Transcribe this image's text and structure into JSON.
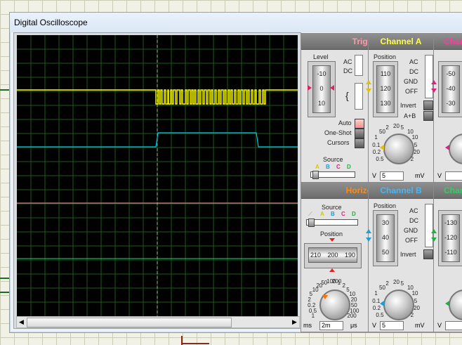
{
  "window": {
    "title": "Digital Oscilloscope"
  },
  "scroll": {
    "left": "◀",
    "right": "▶"
  },
  "colors": {
    "trace_a": "#ffff00",
    "trace_b": "#00c8e8",
    "trace_c": "#ff8fa0",
    "trace_d": "#30d070",
    "cursor": "#b0b0a0",
    "grid": "#1a5a1a"
  },
  "trigger": {
    "title": "Trigger",
    "level_label": "Level",
    "level_ticks": [
      "-10",
      "0",
      "10"
    ],
    "ac": "AC",
    "dc": "DC",
    "auto": "Auto",
    "one_shot": "One-Shot",
    "cursors": "Cursors",
    "source_label": "Source",
    "source_letters": [
      "A",
      "B",
      "C",
      "D"
    ]
  },
  "channel_a": {
    "title": "Channel A",
    "position_label": "Position",
    "position_ticks": [
      "110",
      "120",
      "130"
    ],
    "modes": [
      "AC",
      "DC",
      "GND",
      "OFF"
    ],
    "invert": "Invert",
    "aplusb": "A+B",
    "dial_labels": [
      "0.5",
      "0.2",
      "0.1",
      "1",
      "50",
      "2",
      "20",
      "5",
      "10",
      "10",
      "5",
      "20",
      "2"
    ],
    "value": "5",
    "unit_left": "V",
    "unit_right": "mV"
  },
  "channel_c": {
    "title": "Char",
    "position_ticks": [
      "-50",
      "-40",
      "-30"
    ],
    "unit_left": "V"
  },
  "horizontal": {
    "title": "Horizontal",
    "source_label": "Source",
    "source_letters": [
      "A",
      "B",
      "C",
      "D"
    ],
    "position_label": "Position",
    "position_ticks": [
      "210",
      "200",
      "190"
    ],
    "dial_labels": [
      "1",
      "0.5",
      "0.2",
      "2",
      "5",
      "10",
      "20",
      "50",
      "100",
      "200",
      "1",
      "2",
      "5",
      "10",
      "20",
      "50",
      "100",
      "200"
    ],
    "value": "2m",
    "unit_left": "ms",
    "unit_right": "μs"
  },
  "channel_b": {
    "title": "Channel B",
    "position_label": "Position",
    "position_ticks": [
      "30",
      "40",
      "50"
    ],
    "modes": [
      "AC",
      "DC",
      "GND",
      "OFF"
    ],
    "invert": "Invert",
    "dial_labels": [
      "0.5",
      "0.2",
      "0.1",
      "1",
      "50",
      "2",
      "20",
      "5",
      "10",
      "10",
      "5",
      "20",
      "2"
    ],
    "value": "5",
    "unit_left": "V",
    "unit_right": "mV"
  },
  "channel_d": {
    "title": "Char",
    "position_ticks": [
      "-130",
      "-120",
      "-110"
    ],
    "unit_left": "V"
  }
}
